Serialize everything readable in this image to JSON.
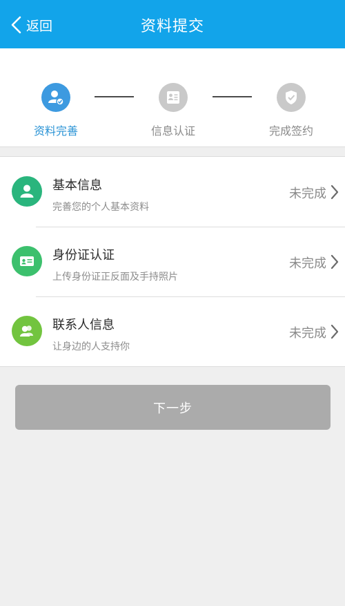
{
  "header": {
    "back_label": "返回",
    "title": "资料提交"
  },
  "steps": [
    {
      "label": "资料完善",
      "icon": "user-check-icon",
      "state": "active"
    },
    {
      "label": "信息认证",
      "icon": "id-document-icon",
      "state": "inactive"
    },
    {
      "label": "完成签约",
      "icon": "shield-check-icon",
      "state": "inactive"
    }
  ],
  "items": [
    {
      "title": "基本信息",
      "subtitle": "完善您的个人基本资料",
      "status": "未完成",
      "icon": "person-icon",
      "color": "#2ab57d"
    },
    {
      "title": "身份证认证",
      "subtitle": "上传身份证正反面及手持照片",
      "status": "未完成",
      "icon": "id-card-icon",
      "color": "#3cc06d"
    },
    {
      "title": "联系人信息",
      "subtitle": "让身边的人支持你",
      "status": "未完成",
      "icon": "contacts-icon",
      "color": "#72c43f"
    }
  ],
  "next_button": "下一步",
  "colors": {
    "header": "#12a4ea",
    "active_step": "#3d9ae0",
    "inactive_step": "#c9c9c9",
    "button_disabled": "#ababab"
  }
}
